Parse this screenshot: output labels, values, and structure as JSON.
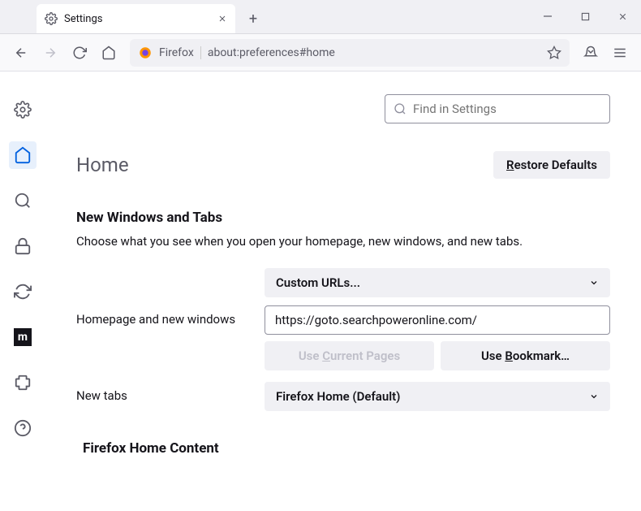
{
  "window": {
    "tab_title": "Settings"
  },
  "toolbar": {
    "address_prefix": "Firefox",
    "url": "about:preferences#home"
  },
  "search": {
    "placeholder": "Find in Settings"
  },
  "page": {
    "title": "Home",
    "restore_button": "Restore Defaults",
    "section1_title": "New Windows and Tabs",
    "section1_desc": "Choose what you see when you open your homepage, new windows, and new tabs.",
    "homepage_label": "Homepage and new windows",
    "homepage_select": "Custom URLs...",
    "homepage_url": "https://goto.searchpoweronline.com/",
    "use_current": "Use Current Pages",
    "use_bookmark": "Use Bookmark…",
    "newtabs_label": "New tabs",
    "newtabs_select": "Firefox Home (Default)",
    "section2_title": "Firefox Home Content"
  }
}
